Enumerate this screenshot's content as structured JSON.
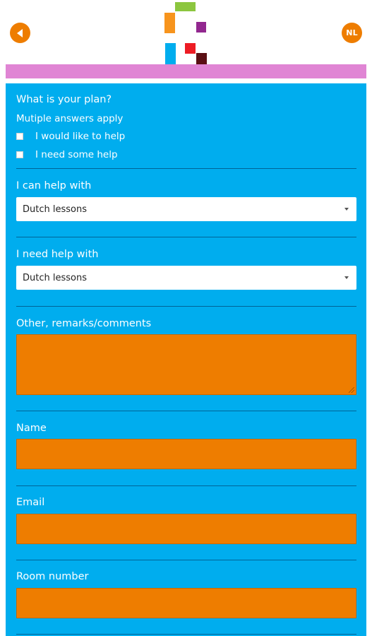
{
  "header": {
    "lang_label": "NL",
    "back_icon": "arrow-left-icon",
    "logo_colors": [
      "#8cc63f",
      "#f7941d",
      "#92278f",
      "#00adee",
      "#ed1c24",
      "#5a0f14"
    ]
  },
  "form": {
    "plan": {
      "title": "What is your plan?",
      "hint": "Mutiple answers apply",
      "options": [
        {
          "label": "I would like to help",
          "checked": false
        },
        {
          "label": "I need some help",
          "checked": false
        }
      ]
    },
    "can_help": {
      "label": "I can help with",
      "value": "Dutch lessons"
    },
    "need_help": {
      "label": "I need help with",
      "value": "Dutch lessons"
    },
    "remarks": {
      "label": "Other, remarks/comments",
      "value": ""
    },
    "name": {
      "label": "Name",
      "value": ""
    },
    "email": {
      "label": "Email",
      "value": ""
    },
    "room": {
      "label": "Room number",
      "value": ""
    }
  },
  "colors": {
    "card_bg": "#00adee",
    "field_bg": "#ee7d00",
    "pink_bar": "#e085d4",
    "accent": "#ee7d00"
  }
}
